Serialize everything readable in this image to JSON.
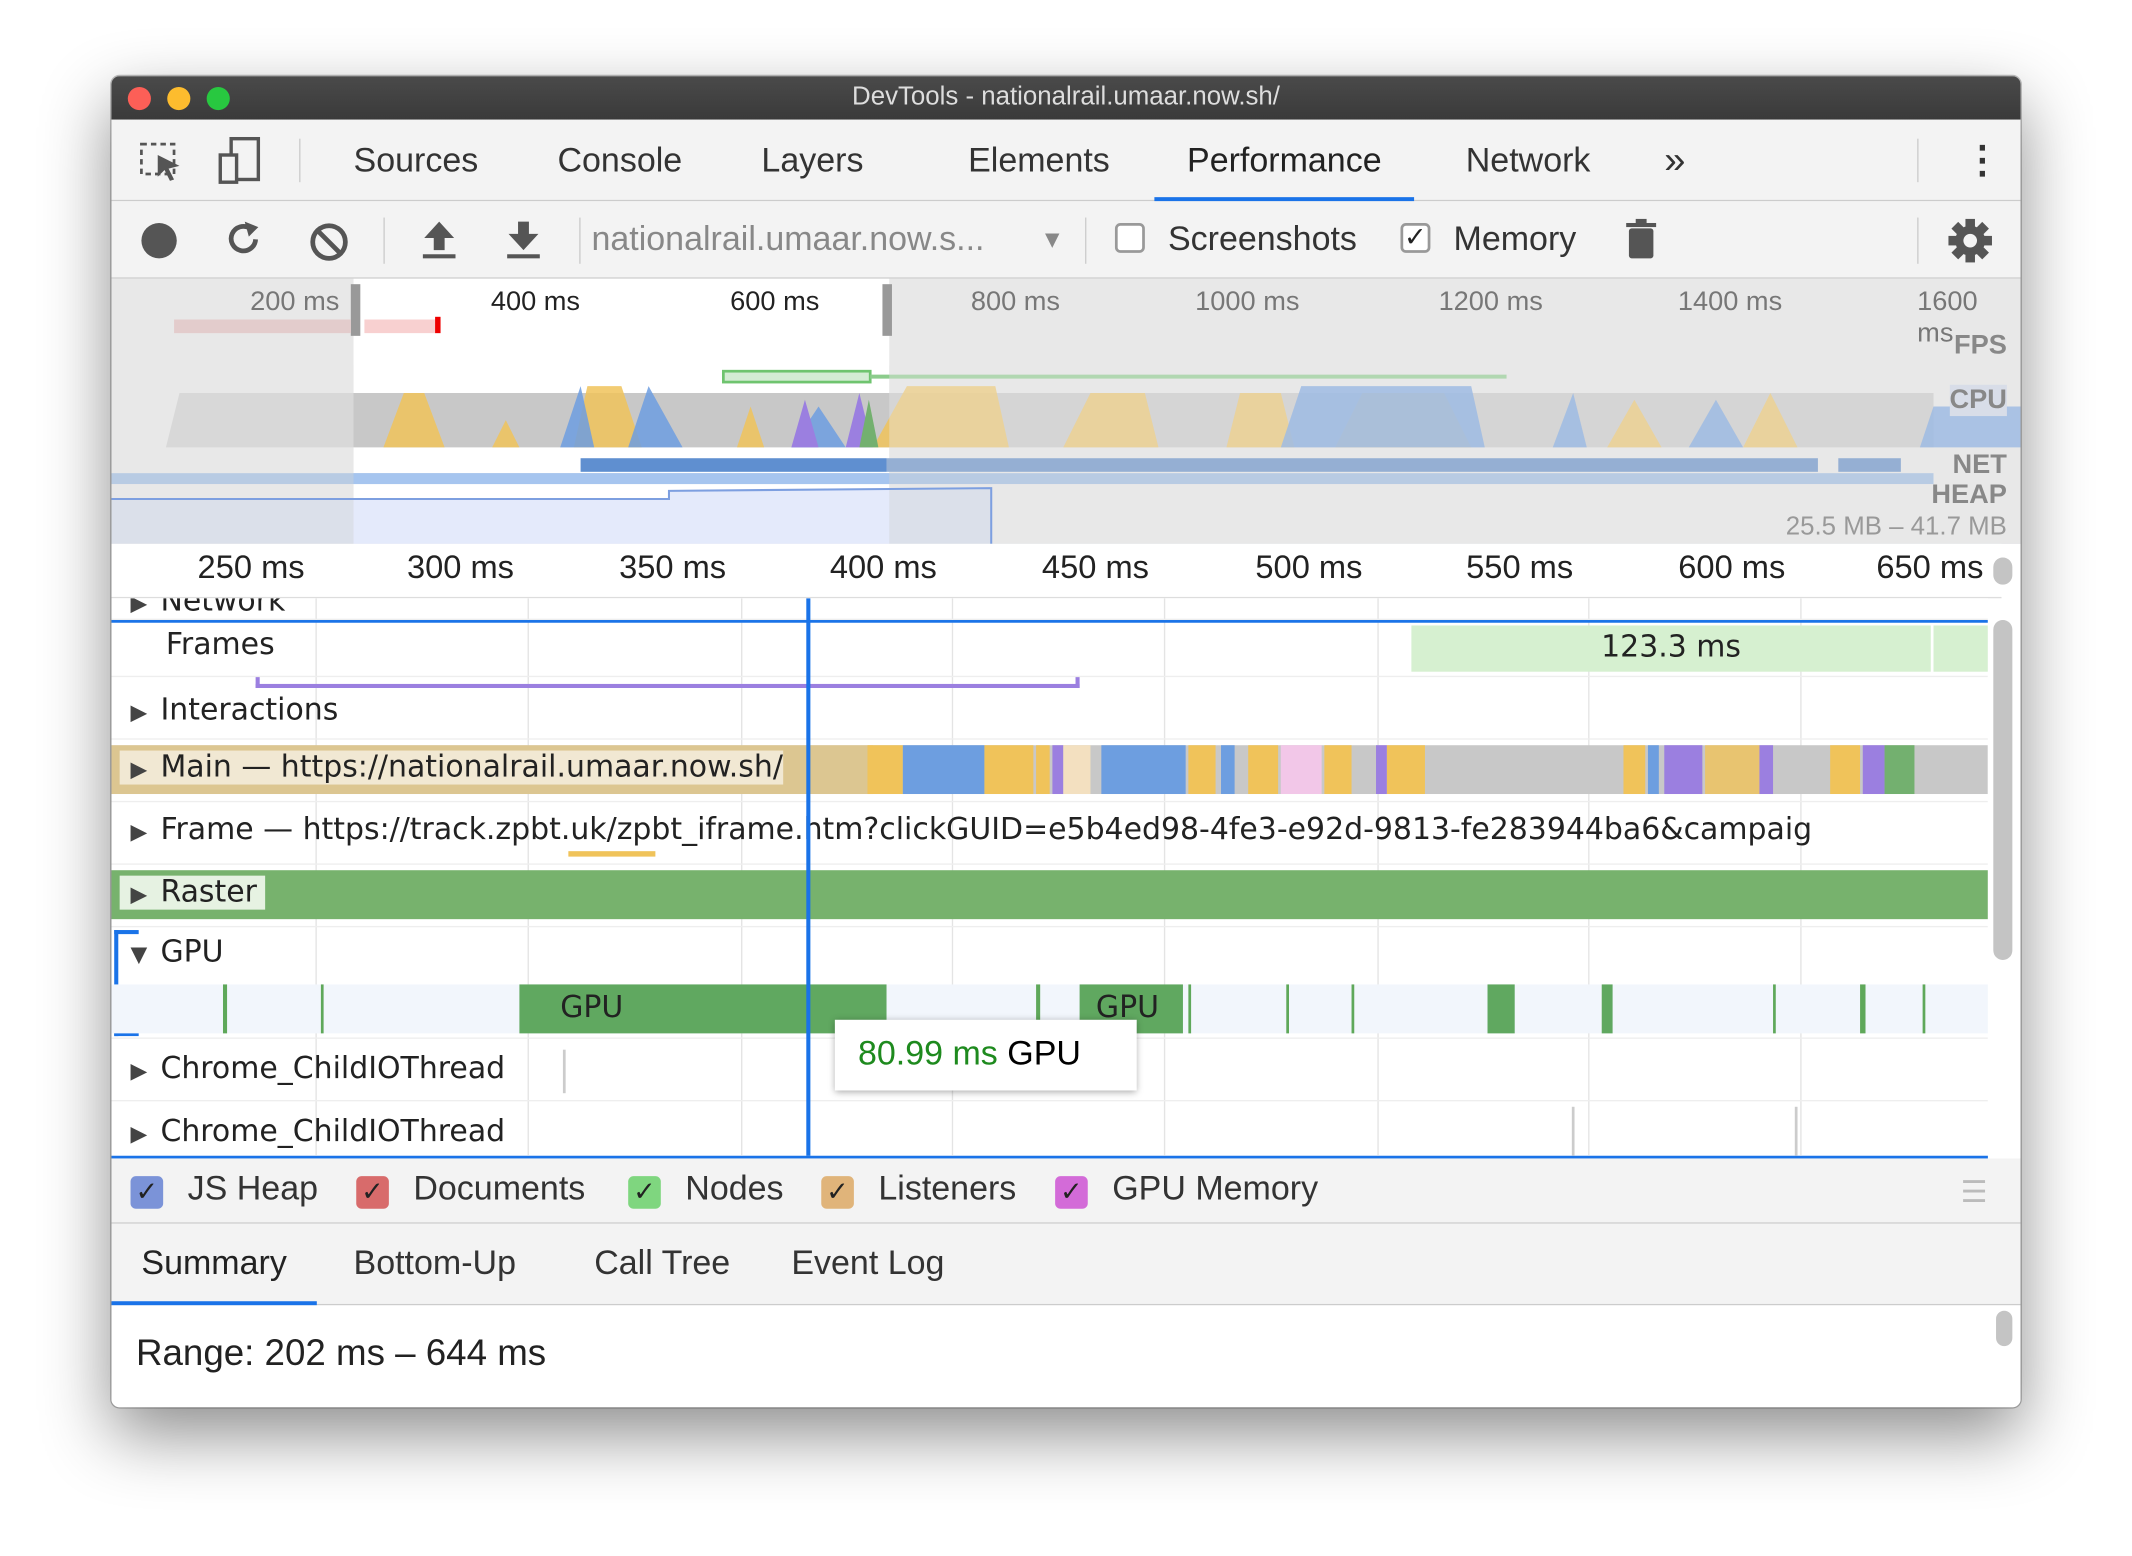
{
  "window": {
    "title": "DevTools - nationalrail.umaar.now.sh/"
  },
  "tabs": [
    {
      "label": "Sources"
    },
    {
      "label": "Console"
    },
    {
      "label": "Layers"
    },
    {
      "label": "Elements"
    },
    {
      "label": "Performance",
      "active": true
    },
    {
      "label": "Network"
    }
  ],
  "toolbar": {
    "url_select": "nationalrail.umaar.now.s...",
    "screenshots_label": "Screenshots",
    "screenshots_checked": false,
    "memory_label": "Memory",
    "memory_checked": true
  },
  "overview": {
    "ticks": [
      "200 ms",
      "400 ms",
      "600 ms",
      "800 ms",
      "1000 ms",
      "1200 ms",
      "1400 ms",
      "1600 ms"
    ],
    "labels": {
      "fps": "FPS",
      "cpu": "CPU",
      "net": "NET",
      "heap": "HEAP"
    },
    "heap_range": "25.5 MB – 41.7 MB"
  },
  "ruler": {
    "ticks": [
      "250 ms",
      "300 ms",
      "350 ms",
      "400 ms",
      "450 ms",
      "500 ms",
      "550 ms",
      "600 ms",
      "650 ms"
    ]
  },
  "tracks": {
    "network": "Network",
    "frames": "Frames",
    "frame_duration": "123.3 ms",
    "interactions": "Interactions",
    "main": "Main — https://nationalrail.umaar.now.sh/",
    "frame": "Frame — https://track.zpbt.uk/zpbt_iframe.htm?clickGUID=e5b4ed98-4fe3-e92d-9813-fe283944ba6&campaig",
    "raster": "Raster",
    "gpu": "GPU",
    "gpu_block1": "GPU",
    "gpu_block2": "GPU",
    "child1": "Chrome_ChildIOThread",
    "child2": "Chrome_ChildIOThread"
  },
  "tooltip": {
    "duration": "80.99 ms",
    "name": "GPU"
  },
  "memory_counters": [
    {
      "label": "JS Heap",
      "color": "#7b93d8",
      "checked": true
    },
    {
      "label": "Documents",
      "color": "#d86b6b",
      "checked": true
    },
    {
      "label": "Nodes",
      "color": "#7fd67f",
      "checked": true
    },
    {
      "label": "Listeners",
      "color": "#e0b47a",
      "checked": true
    },
    {
      "label": "GPU Memory",
      "color": "#d36bd8",
      "checked": true
    }
  ],
  "bottom_tabs": [
    {
      "label": "Summary",
      "active": true
    },
    {
      "label": "Bottom-Up"
    },
    {
      "label": "Call Tree"
    },
    {
      "label": "Event Log"
    }
  ],
  "summary": {
    "range": "Range: 202 ms – 644 ms"
  },
  "colors": {
    "accent": "#1a73e8",
    "scripting": "#f0c35a",
    "rendering": "#9b7fe0",
    "painting": "#73b06f",
    "loading": "#6d9ee0"
  }
}
